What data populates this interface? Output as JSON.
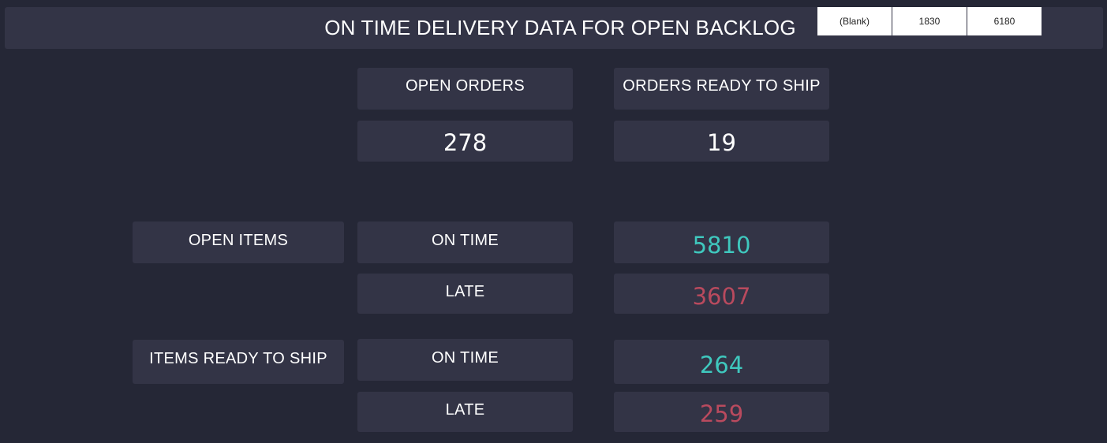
{
  "header": {
    "title": "ON TIME DELIVERY DATA FOR OPEN BACKLOG",
    "slicer": [
      "(Blank)",
      "1830",
      "6180"
    ]
  },
  "orders": {
    "open_orders_label": "OPEN ORDERS",
    "open_orders_value": "278",
    "ready_to_ship_label": "ORDERS READY TO SHIP",
    "ready_to_ship_value": "19"
  },
  "open_items": {
    "label": "OPEN ITEMS",
    "on_time_label": "ON TIME",
    "on_time_value": "5810",
    "late_label": "LATE",
    "late_value": "3607"
  },
  "items_ready": {
    "label": "ITEMS READY TO SHIP",
    "on_time_label": "ON TIME",
    "on_time_value": "264",
    "late_label": "LATE",
    "late_value": "259"
  },
  "colors": {
    "background": "#252736",
    "card": "#333446",
    "on_time": "#3fc8be",
    "late": "#b94a5e"
  }
}
